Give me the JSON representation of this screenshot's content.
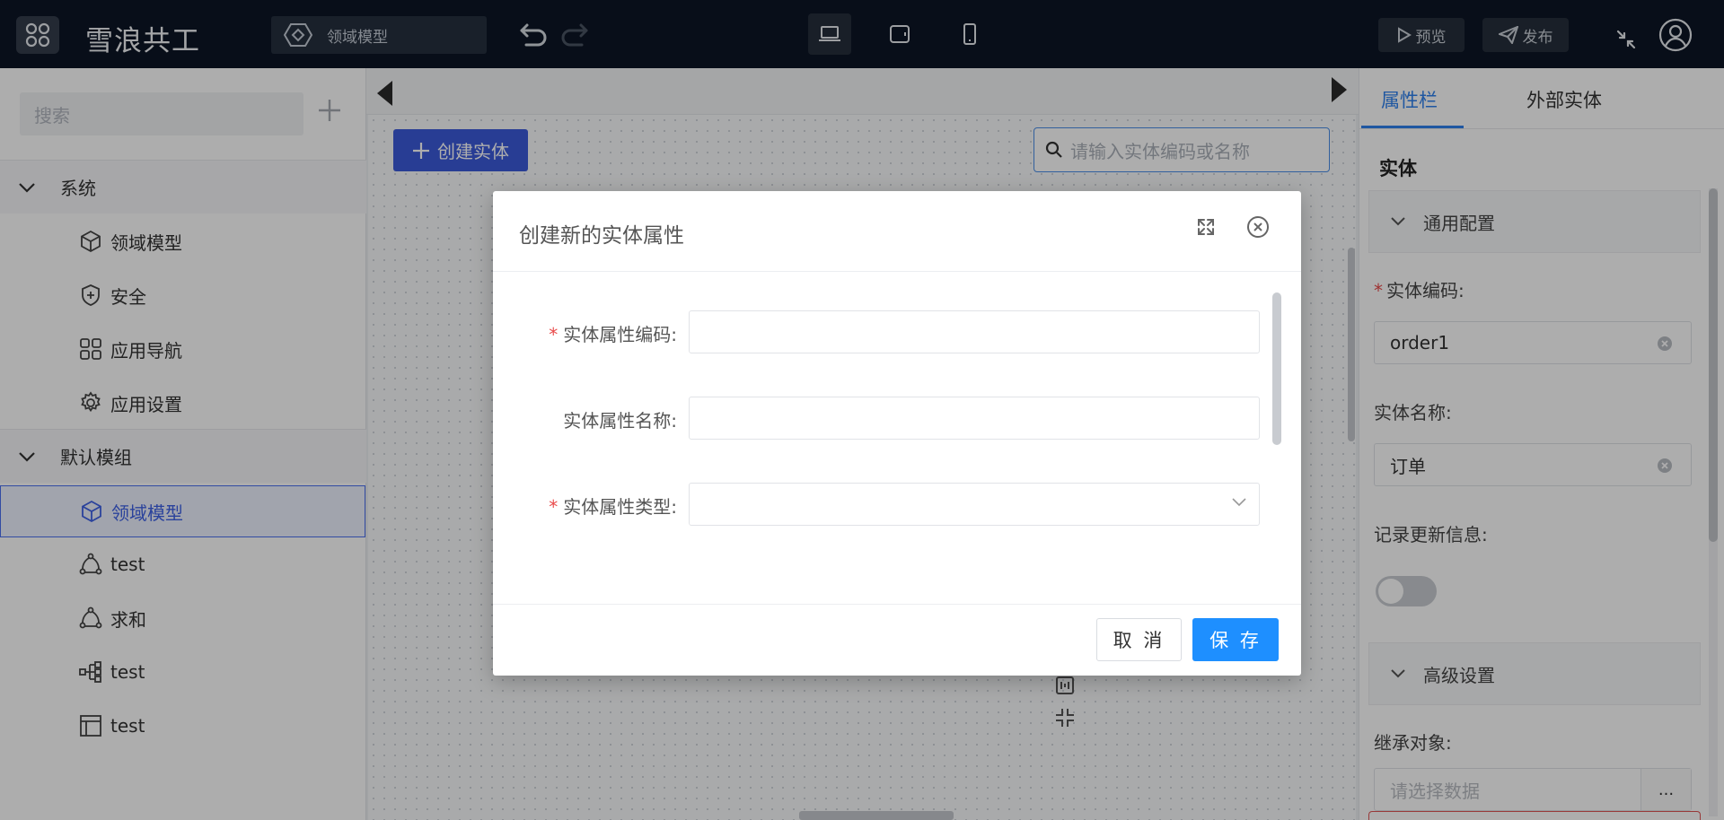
{
  "topbar": {
    "app_title": "雪浪共工",
    "model_select": "领域模型",
    "preview_label": "预览",
    "publish_label": "发布"
  },
  "sidebar": {
    "search_placeholder": "搜索",
    "groups": [
      {
        "label": "系统",
        "items": [
          {
            "label": "领域模型",
            "icon": "cube-icon"
          },
          {
            "label": "安全",
            "icon": "shield-plus-icon"
          },
          {
            "label": "应用导航",
            "icon": "grid-icon"
          },
          {
            "label": "应用设置",
            "icon": "gear-icon"
          }
        ]
      },
      {
        "label": "默认模组",
        "items": [
          {
            "label": "领域模型",
            "icon": "cube-icon",
            "selected": true
          },
          {
            "label": "test",
            "icon": "triangle-nodes-icon"
          },
          {
            "label": "求和",
            "icon": "triangle-nodes-icon"
          },
          {
            "label": "test",
            "icon": "flow-icon"
          },
          {
            "label": "test",
            "icon": "table-icon"
          }
        ]
      }
    ]
  },
  "canvas": {
    "create_entity_label": "创建实体",
    "entity_search_placeholder": "请输入实体编码或名称"
  },
  "right_panel": {
    "tabs": [
      "属性栏",
      "外部实体"
    ],
    "section_title": "实体",
    "general_config": "通用配置",
    "entity_code_label": "实体编码:",
    "entity_code_value": "order1",
    "entity_name_label": "实体名称:",
    "entity_name_value": "订单",
    "record_update_label": "记录更新信息:",
    "record_update_on": false,
    "advanced_settings": "高级设置",
    "inherit_label": "继承对象:",
    "inherit_placeholder": "请选择数据",
    "more_label": "..."
  },
  "modal": {
    "title": "创建新的实体属性",
    "fields": [
      {
        "label": "实体属性编码:",
        "required": true,
        "type": "input",
        "value": ""
      },
      {
        "label": "实体属性名称:",
        "required": false,
        "type": "input",
        "value": ""
      },
      {
        "label": "实体属性类型:",
        "required": true,
        "type": "select",
        "value": ""
      }
    ],
    "cancel_label": "取 消",
    "save_label": "保 存"
  },
  "colors": {
    "topbar_bg": "#0d1626",
    "primary_blue": "#1e8fff",
    "create_button": "#3b5bdb",
    "selected_nav": "#3f62e6",
    "required_star": "#e94b4b"
  }
}
